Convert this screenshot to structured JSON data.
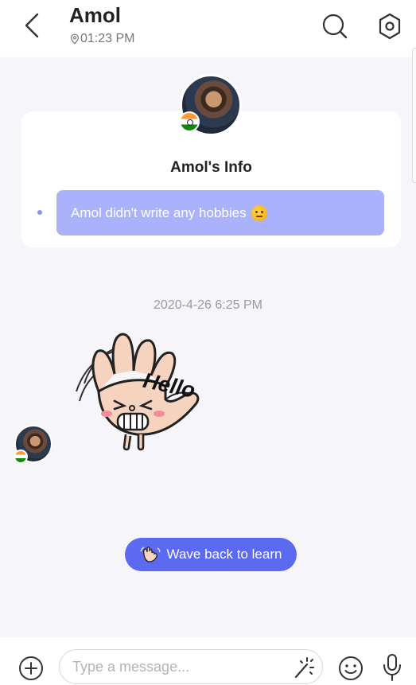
{
  "header": {
    "name": "Amol",
    "time": "01:23 PM",
    "icons": {
      "back": "chevron-left-icon",
      "search": "search-icon",
      "settings": "settings-icon"
    }
  },
  "info_card": {
    "title": "Amol's Info",
    "hobby_text": "Amol didn't write any hobbies"
  },
  "conversation": {
    "timestamp": "2020-4-26 6:25 PM",
    "sticker_text": "Hello"
  },
  "wave_button": {
    "label": "Wave back to learn"
  },
  "composer": {
    "placeholder": "Type a message...",
    "value": ""
  },
  "colors": {
    "accent": "#5b6af0",
    "bubble": "#a9b2fb",
    "background": "#f5f5fa"
  }
}
